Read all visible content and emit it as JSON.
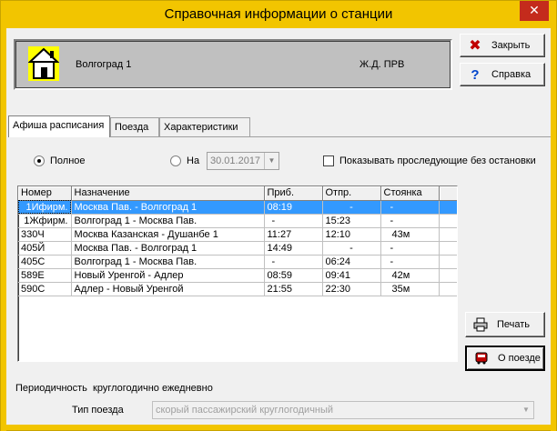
{
  "window": {
    "title": "Справочная информации о станции"
  },
  "station": {
    "name": "Волгоград 1",
    "railway": "Ж.Д. ПРВ"
  },
  "buttons": {
    "close": "Закрыть",
    "help": "Справка",
    "print": "Печать",
    "train": "О поезде"
  },
  "tabs": [
    {
      "label": "Афиша расписания",
      "active": true
    },
    {
      "label": "Поезда",
      "active": false
    },
    {
      "label": "Характеристики",
      "active": false
    }
  ],
  "filters": {
    "full_label": "Полное",
    "on_label": "На",
    "date": "30.01.2017",
    "show_passing_label": "Показывать проследующие без остановки"
  },
  "table": {
    "headers": [
      "Номер",
      "Назначение",
      "Приб.",
      "Отпр.",
      "Стоянка"
    ],
    "rows": [
      [
        "1Ифирм.",
        "Москва Пав. - Волгоград 1",
        "08:19",
        "-",
        "-"
      ],
      [
        "1Жфирм.",
        "Волгоград 1 - Москва Пав.",
        "-",
        "15:23",
        "-"
      ],
      [
        "330Ч",
        "Москва Казанская - Душанбе 1",
        "11:27",
        "12:10",
        "43м"
      ],
      [
        "405Й",
        "Москва Пав. - Волгоград 1",
        "14:49",
        "-",
        "-"
      ],
      [
        "405С",
        "Волгоград 1 - Москва Пав.",
        "-",
        "06:24",
        "-"
      ],
      [
        "589Е",
        "Новый Уренгой - Адлер",
        "08:59",
        "09:41",
        "42м"
      ],
      [
        "590С",
        "Адлер - Новый Уренгой",
        "21:55",
        "22:30",
        "35м"
      ]
    ],
    "selected_row": 0
  },
  "info": {
    "periodicity": "Периодичность  круглогодично ежедневно",
    "train_type_label": "Тип поезда",
    "train_type_value": "скорый пассажирский круглогодичный"
  },
  "colors": {
    "titlebar": "#f2c500",
    "selection": "#3399ff",
    "close": "#c42b1c"
  }
}
